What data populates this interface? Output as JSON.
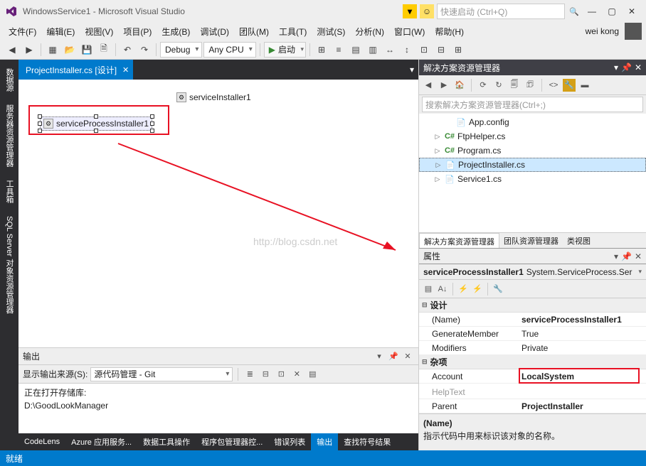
{
  "title": "WindowsService1 - Microsoft Visual Studio",
  "quick_launch_placeholder": "快速启动 (Ctrl+Q)",
  "user": "wei kong",
  "menu": [
    "文件(F)",
    "编辑(E)",
    "视图(V)",
    "项目(P)",
    "生成(B)",
    "调试(D)",
    "团队(M)",
    "工具(T)",
    "测试(S)",
    "分析(N)",
    "窗口(W)",
    "帮助(H)"
  ],
  "toolbar": {
    "config": "Debug",
    "platform": "Any CPU",
    "start": "启动"
  },
  "side_tabs": [
    "数据源",
    "服务器资源管理器",
    "工具箱",
    "SQL Server 对象资源管理器"
  ],
  "file_tab": "ProjectInstaller.cs [设计]",
  "components": {
    "service_installer": "serviceInstaller1",
    "service_process_installer": "serviceProcessInstaller1"
  },
  "watermark": "http://blog.csdn.net",
  "output": {
    "title": "输出",
    "source_label": "显示输出来源(S):",
    "source_value": "源代码管理 - Git",
    "lines": [
      "正在打开存储库:",
      "D:\\GoodLookManager"
    ]
  },
  "bottom_tabs": [
    "CodeLens",
    "Azure 应用服务...",
    "数据工具操作",
    "程序包管理器控...",
    "错误列表",
    "输出",
    "查找符号结果"
  ],
  "bottom_active": "输出",
  "solution_explorer": {
    "title": "解决方案资源管理器",
    "search_placeholder": "搜索解决方案资源管理器(Ctrl+;)",
    "items": [
      {
        "indent": 36,
        "icon": "📄",
        "label": "App.config",
        "cs": false
      },
      {
        "indent": 20,
        "exp": "▷",
        "icon": "C#",
        "label": "FtpHelper.cs",
        "cs": true
      },
      {
        "indent": 20,
        "exp": "▷",
        "icon": "C#",
        "label": "Program.cs",
        "cs": true
      },
      {
        "indent": 20,
        "exp": "▷",
        "icon": "📄",
        "label": "ProjectInstaller.cs",
        "cs": false,
        "sel": true
      },
      {
        "indent": 20,
        "exp": "▷",
        "icon": "📄",
        "label": "Service1.cs",
        "cs": false
      }
    ],
    "tabs": [
      "解决方案资源管理器",
      "团队资源管理器",
      "类视图"
    ]
  },
  "properties": {
    "title": "属性",
    "object_name": "serviceProcessInstaller1",
    "object_type": "System.ServiceProcess.Ser",
    "cats": [
      {
        "name": "设计",
        "rows": [
          {
            "n": "(Name)",
            "v": "serviceProcessInstaller1",
            "b": true
          },
          {
            "n": "GenerateMember",
            "v": "True"
          },
          {
            "n": "Modifiers",
            "v": "Private"
          }
        ]
      },
      {
        "name": "杂项",
        "rows": [
          {
            "n": "Account",
            "v": "LocalSystem",
            "b": true,
            "hl": true
          },
          {
            "n": "HelpText",
            "v": "",
            "dim": true
          },
          {
            "n": "Parent",
            "v": "ProjectInstaller",
            "b": true
          }
        ]
      }
    ],
    "desc_title": "(Name)",
    "desc_body": "指示代码中用来标识该对象的名称。"
  },
  "status": "就绪"
}
